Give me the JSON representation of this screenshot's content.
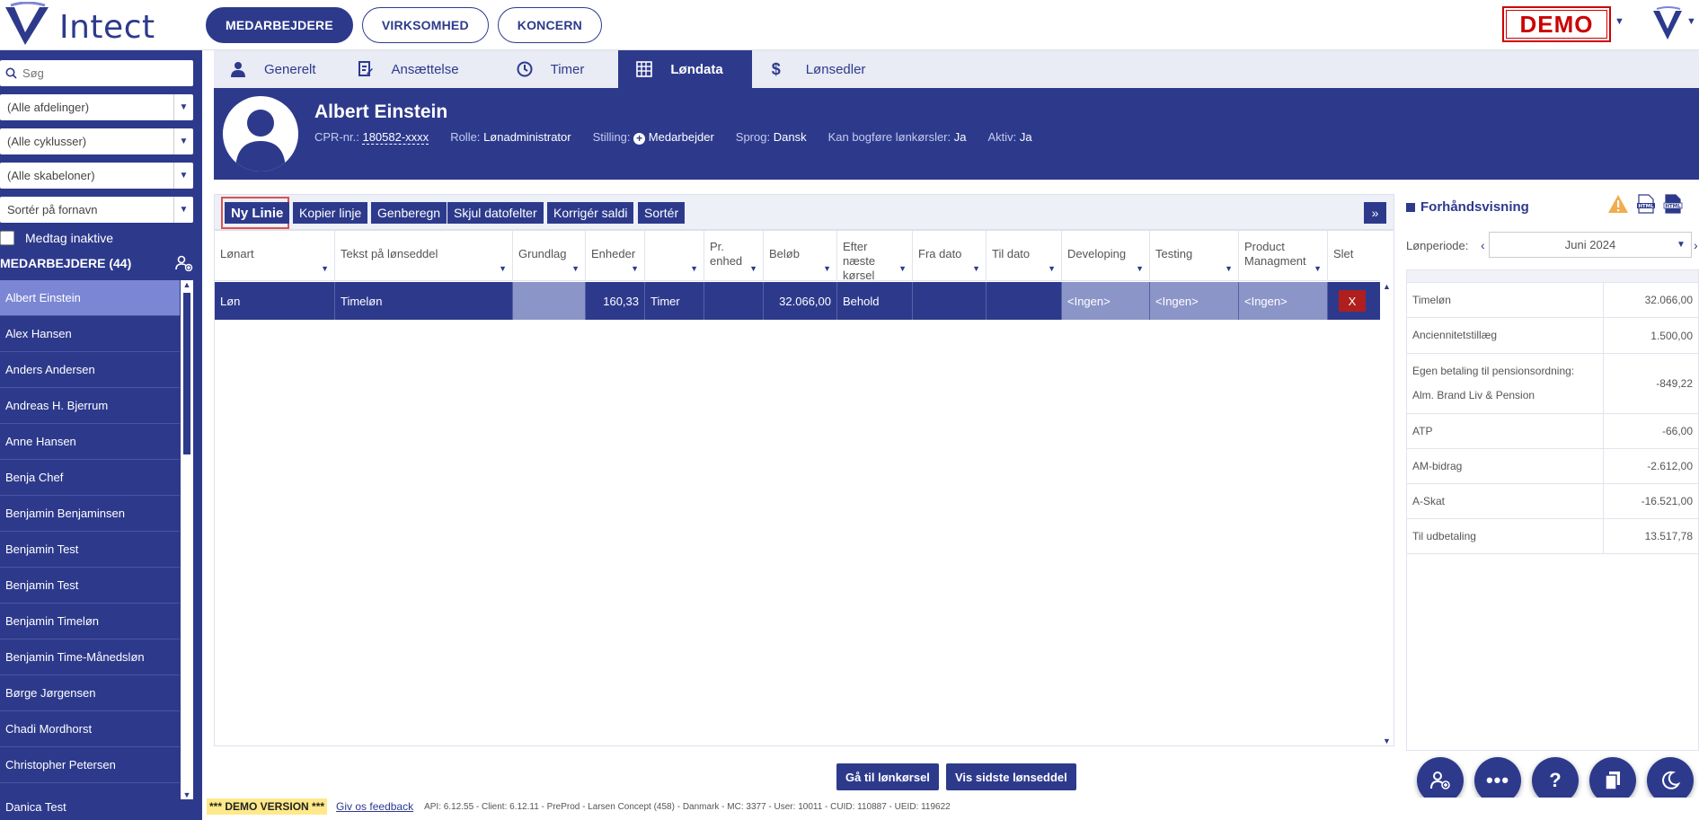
{
  "header": {
    "logo_text": "Intect",
    "nav": [
      "MEDARBEJDERE",
      "VIRKSOMHED",
      "KONCERN"
    ],
    "demo_label": "DEMO"
  },
  "sidebar": {
    "search_placeholder": "Søg",
    "filters": [
      "(Alle afdelinger)",
      "(Alle cyklusser)",
      "(Alle skabeloner)",
      "Sortér på fornavn"
    ],
    "include_inactive": "Medtag inaktive",
    "heading": "MEDARBEJDERE (44)",
    "employees": [
      "Albert Einstein",
      "Alex Hansen",
      "Anders Andersen",
      "Andreas H. Bjerrum",
      "Anne Hansen",
      "Benja Chef",
      "Benjamin Benjaminsen",
      "Benjamin Test",
      "Benjamin Test",
      "Benjamin Timeløn",
      "Benjamin Time-Månedsløn",
      "Børge Jørgensen",
      "Chadi Mordhorst",
      "Christopher Petersen",
      "Danica Test"
    ]
  },
  "tabs": [
    "Generelt",
    "Ansættelse",
    "Timer",
    "Løndata",
    "Lønsedler"
  ],
  "profile": {
    "name": "Albert Einstein",
    "cpr_label": "CPR-nr.:",
    "cpr": "180582-xxxx",
    "role_label": "Rolle:",
    "role": "Lønadministrator",
    "position_label": "Stilling:",
    "position": "Medarbejder",
    "lang_label": "Sprog:",
    "lang": "Dansk",
    "book_label": "Kan bogføre lønkørsler:",
    "book": "Ja",
    "active_label": "Aktiv:",
    "active": "Ja"
  },
  "toolbar": {
    "new_line": "Ny Linie",
    "copy_line": "Kopier linje",
    "recalc": "Genberegn",
    "hide_dates": "Skjul datofelter",
    "correct_balance": "Korrigér saldi",
    "sort": "Sortér",
    "expand": "»"
  },
  "grid": {
    "columns": [
      "Lønart",
      "Tekst på lønseddel",
      "Grundlag",
      "Enheder",
      "",
      "Pr. enhed",
      "Beløb",
      "Efter næste kørsel",
      "Fra dato",
      "Til dato",
      "Developing",
      "Testing",
      "Product Managment",
      "Slet"
    ],
    "row": {
      "type": "Løn",
      "text": "Timeløn",
      "basis": "",
      "units": "160,33",
      "unit_type": "Timer",
      "per_unit": "",
      "amount": "32.066,00",
      "after_next": "Behold",
      "from": "",
      "to": "",
      "developing": "<Ingen>",
      "testing": "<Ingen>",
      "product": "<Ingen>",
      "delete": "X"
    }
  },
  "buttons": {
    "go_payroll": "Gå til lønkørsel",
    "show_last": "Vis sidste lønseddel"
  },
  "preview": {
    "title": "Forhåndsvisning",
    "period_label": "Lønperiode:",
    "period": "Juni 2024",
    "lines": [
      {
        "label": "Timeløn",
        "value": "32.066,00"
      },
      {
        "label": "Anciennitetstillæg",
        "value": "1.500,00"
      },
      {
        "label": "Egen betaling til pensionsordning: Alm. Brand Liv & Pension",
        "value": "-849,22"
      },
      {
        "label": "ATP",
        "value": "-66,00"
      },
      {
        "label": "AM-bidrag",
        "value": "-2.612,00"
      },
      {
        "label": "A-Skat",
        "value": "-16.521,00"
      },
      {
        "label": "Til udbetaling",
        "value": "13.517,78"
      }
    ]
  },
  "footer": {
    "demo": "*** DEMO VERSION ***",
    "feedback": "Giv os feedback",
    "info": "API: 6.12.55 - Client: 6.12.11 - PreProd - Larsen Concept (458) - Danmark - MC: 3377 - User: 10011 - CUID: 110887 - UEID: 119622"
  },
  "colors": {
    "brand": "#2d3a8c",
    "selected": "#7b87d4",
    "danger": "#b01e1e",
    "demo": "#cc0000"
  }
}
